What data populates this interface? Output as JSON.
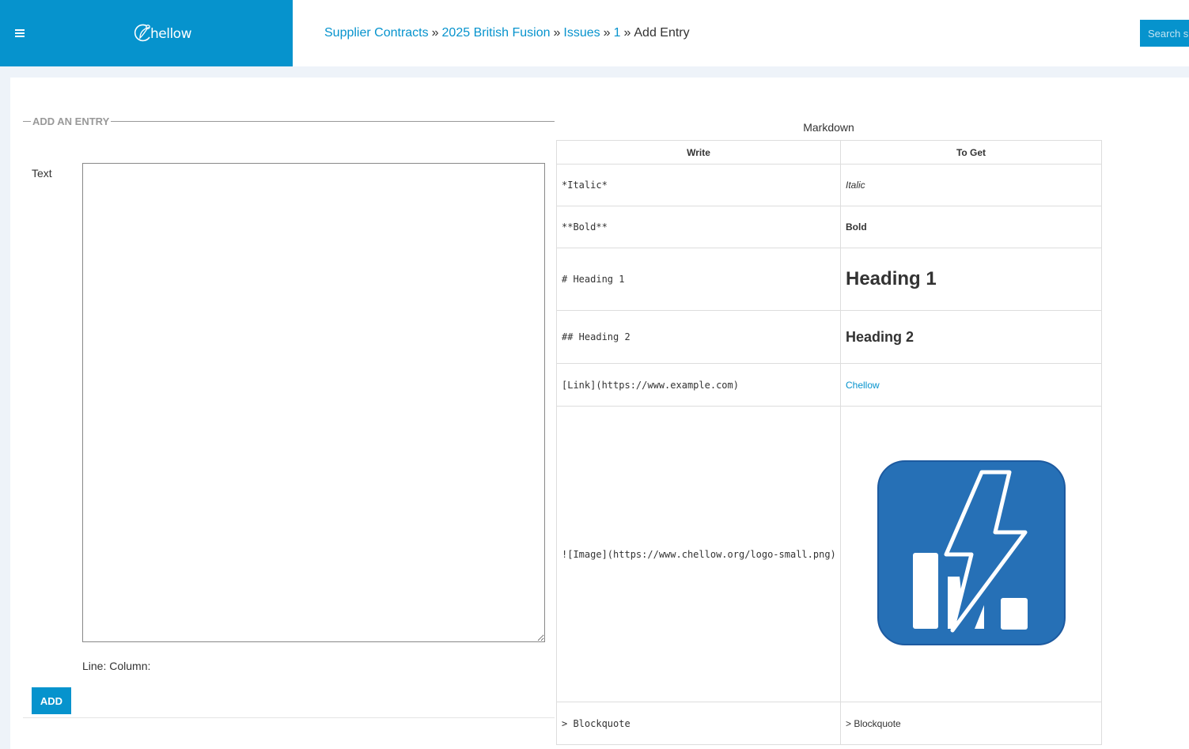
{
  "header": {
    "logo_text": "hellow",
    "brand_color": "#0693cd",
    "breadcrumbs": [
      {
        "label": "Supplier Contracts",
        "link": true
      },
      {
        "label": "2025 British Fusion",
        "link": true
      },
      {
        "label": "Issues",
        "link": true
      },
      {
        "label": "1",
        "link": true
      },
      {
        "label": "Add Entry",
        "link": false
      }
    ],
    "separator": "»",
    "search_placeholder": "Search s"
  },
  "form": {
    "legend": "ADD AN ENTRY",
    "text_label": "Text",
    "text_value": "",
    "cursor_position": "Line: Column:",
    "submit_label": "ADD"
  },
  "markdown": {
    "caption": "Markdown",
    "headers": [
      "Write",
      "To Get"
    ],
    "rows": [
      {
        "write": "*Italic*",
        "get": "Italic"
      },
      {
        "write": "**Bold**",
        "get": "Bold"
      },
      {
        "write": "# Heading 1",
        "get": "Heading 1"
      },
      {
        "write": "## Heading 2",
        "get": "Heading 2"
      },
      {
        "write": "[Link](https://www.example.com)",
        "get": "Chellow"
      },
      {
        "write": "![Image](https://www.chellow.org/logo-small.png)",
        "get": "chellow-logo-image"
      },
      {
        "write": "> Blockquote",
        "get": "> Blockquote"
      }
    ],
    "logo_color": "#2670b6"
  }
}
